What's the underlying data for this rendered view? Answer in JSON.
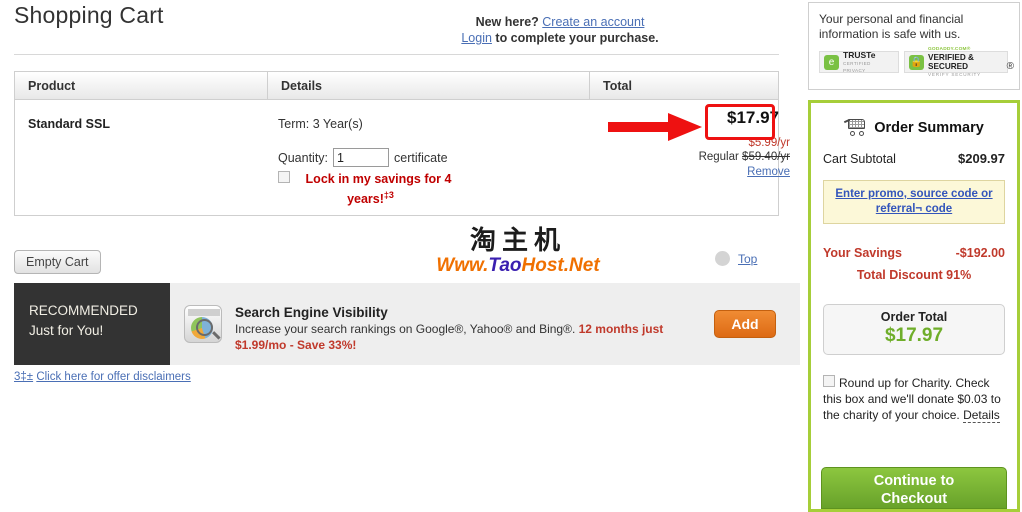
{
  "page": {
    "title": "Shopping Cart"
  },
  "account_prompt": {
    "new_here": "New here?",
    "create_link": "Create an account",
    "login_link": "Login",
    "tail": " to complete your purchase."
  },
  "trust": {
    "text": "Your personal and financial information is safe with us.",
    "badges": [
      {
        "name": "TRUSTe",
        "line1": "TRUSTe",
        "line2": "CERTIFIED PRIVACY",
        "icon": "truste-shield-icon"
      },
      {
        "name": "GoDaddy",
        "line1": "GODADDY.COM®",
        "line2": "VERIFIED & SECURED",
        "line3": "VERIFY SECURITY",
        "icon": "padlock-icon"
      }
    ],
    "registered_mark": "®"
  },
  "table": {
    "headers": [
      "Product",
      "Details",
      "Total"
    ],
    "rows": [
      {
        "product": "Standard SSL",
        "term": "Term: 3 Year(s)",
        "quantity_label": "Quantity:",
        "quantity_value": "1",
        "quantity_unit": "certificate",
        "lock_offer": "Lock in my savings for 4 years!",
        "lock_offer_footnote": "‡3",
        "price": "$17.97",
        "price_per_year": "$5.99/yr",
        "regular_label": "Regular",
        "regular_price": "$59.40/yr",
        "remove_label": "Remove"
      }
    ]
  },
  "actions": {
    "empty_cart": "Empty Cart",
    "top": "Top"
  },
  "watermark": {
    "chinese": "淘主机",
    "latin_parts": [
      {
        "t": "W",
        "c": "orange"
      },
      {
        "t": "ww.",
        "c": "orange"
      },
      {
        "t": "T",
        "c": "blue"
      },
      {
        "t": "ao",
        "c": "blue"
      },
      {
        "t": "H",
        "c": "orange"
      },
      {
        "t": "ost.",
        "c": "orange"
      },
      {
        "t": "N",
        "c": "orange"
      },
      {
        "t": "et",
        "c": "orange"
      }
    ],
    "latin": "Www.TaoHost.Net"
  },
  "recommendation": {
    "badge_line1": "RECOMMENDED",
    "badge_line2": "Just for You!",
    "title": "Search Engine Visibility",
    "desc_plain": "Increase your search rankings on Google®, Yahoo® and Bing®. ",
    "desc_highlight": "12 months just $1.99/mo - Save 33%!",
    "add_label": "Add",
    "icon": "search-engine-visibility-icon"
  },
  "disclaimers": {
    "marks": "3‡±",
    "text": "Click here for offer disclaimers"
  },
  "summary": {
    "title": "Order Summary",
    "cart_icon": "shopping-cart-icon",
    "subtotal_label": "Cart Subtotal",
    "subtotal_value": "$209.97",
    "promo_line1": "Enter promo, source code or",
    "promo_line2": "referral¬ code",
    "savings_label": "Your Savings",
    "savings_value": "-$192.00",
    "discount_text": "Total Discount 91%",
    "order_total_label": "Order Total",
    "order_total_value": "$17.97",
    "charity_text": "Round up for Charity. Check this box and we'll donate $0.03 to the charity of your choice.",
    "charity_details": "Details",
    "checkout_line1": "Continue to",
    "checkout_line2": "Checkout"
  },
  "colors": {
    "accent_green": "#a6ce39",
    "total_green": "#6fae2a",
    "savings_red": "#c0392b",
    "link_blue": "#4a6fb5",
    "annotation_red": "#ee1111",
    "add_orange": "#dd6a14"
  }
}
